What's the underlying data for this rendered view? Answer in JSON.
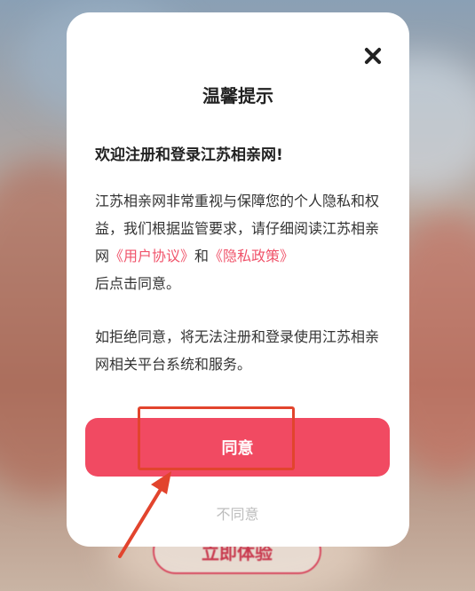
{
  "background": {
    "button_label": "立即体验"
  },
  "dialog": {
    "title": "温馨提示",
    "heading": "欢迎注册和登录江苏相亲网!",
    "para1": {
      "text_a": "江苏相亲网非常重视与保障您的个人隐私和权益，我们根据监管要求，请仔细阅读江苏相亲网",
      "link_user_agreement": "《用户协议》",
      "text_and": "和",
      "link_privacy_policy": "《隐私政策》",
      "text_b": "后点击同意。"
    },
    "para2": "如拒绝同意，将无法注册和登录使用江苏相亲网相关平台系统和服务。",
    "agree_label": "同意",
    "disagree_label": "不同意"
  },
  "colors": {
    "accent": "#f14a62",
    "link": "#f0546b",
    "annotation": "#e2442d"
  },
  "icons": [
    "close-icon",
    "arrow-annotation"
  ]
}
